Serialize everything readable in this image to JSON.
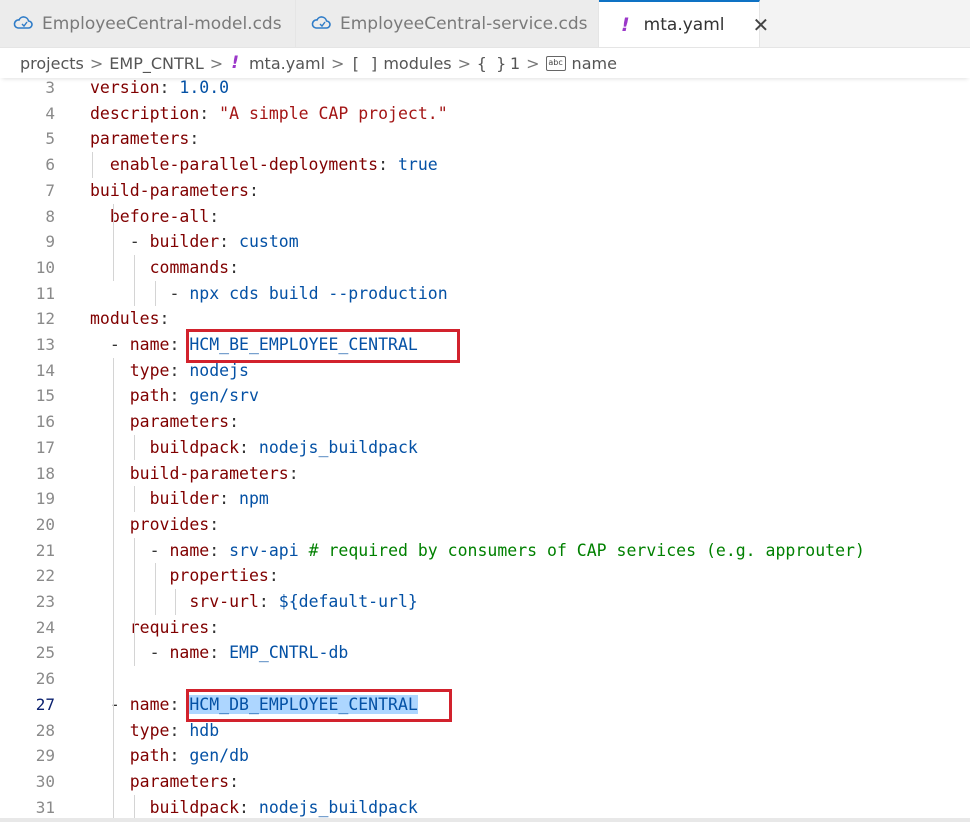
{
  "tabs": [
    {
      "label": "EmployeeCentral-model.cds",
      "icon": "cds-file-icon",
      "active": false
    },
    {
      "label": "EmployeeCentral-service.cds",
      "icon": "cds-file-icon",
      "active": false
    },
    {
      "label": "mta.yaml",
      "icon": "yaml-exclamation-icon",
      "active": true
    }
  ],
  "close_glyph": "✕",
  "breadcrumb": {
    "projects": "projects",
    "folder": "EMP_CNTRL",
    "file": "mta.yaml",
    "modules": "modules",
    "index": "1",
    "name": "name",
    "separator": ">",
    "bang": "!",
    "array_glyph": "[ ]",
    "object_glyph": "{ }",
    "abc_glyph": "abc"
  },
  "editor": {
    "lines": [
      {
        "n": "3",
        "key": "version",
        "val": "1.0.0",
        "valType": "v",
        "indent": ""
      },
      {
        "n": "4",
        "key": "description",
        "val": "\"A simple CAP project.\"",
        "valType": "s",
        "indent": ""
      },
      {
        "n": "5",
        "key": "parameters",
        "val": "",
        "valType": "",
        "indent": ""
      },
      {
        "n": "6",
        "key": "enable-parallel-deployments",
        "val": "true",
        "valType": "v",
        "indent": "  "
      },
      {
        "n": "7",
        "key": "build-parameters",
        "val": "",
        "valType": "",
        "indent": ""
      },
      {
        "n": "8",
        "key": "before-all",
        "val": "",
        "valType": "",
        "indent": "  "
      },
      {
        "n": "9",
        "key": "builder",
        "val": "custom",
        "valType": "v",
        "indent": "    - "
      },
      {
        "n": "10",
        "key": "commands",
        "val": "",
        "valType": "",
        "indent": "      "
      },
      {
        "n": "11",
        "key": "",
        "val": "npx cds build --production",
        "valType": "v",
        "indent": "        - "
      },
      {
        "n": "12",
        "key": "modules",
        "val": "",
        "valType": "",
        "indent": ""
      },
      {
        "n": "13",
        "key": "name",
        "val": "HCM_BE_EMPLOYEE_CENTRAL",
        "valType": "v",
        "indent": "  - "
      },
      {
        "n": "14",
        "key": "type",
        "val": "nodejs",
        "valType": "v",
        "indent": "    "
      },
      {
        "n": "15",
        "key": "path",
        "val": "gen/srv",
        "valType": "v",
        "indent": "    "
      },
      {
        "n": "16",
        "key": "parameters",
        "val": "",
        "valType": "",
        "indent": "    "
      },
      {
        "n": "17",
        "key": "buildpack",
        "val": "nodejs_buildpack",
        "valType": "v",
        "indent": "      "
      },
      {
        "n": "18",
        "key": "build-parameters",
        "val": "",
        "valType": "",
        "indent": "    "
      },
      {
        "n": "19",
        "key": "builder",
        "val": "npm",
        "valType": "v",
        "indent": "      "
      },
      {
        "n": "20",
        "key": "provides",
        "val": "",
        "valType": "",
        "indent": "    "
      },
      {
        "n": "21",
        "key": "name",
        "val": "srv-api",
        "valType": "v",
        "indent": "      - ",
        "comment": "# required by consumers of CAP services (e.g. approuter)"
      },
      {
        "n": "22",
        "key": "properties",
        "val": "",
        "valType": "",
        "indent": "        "
      },
      {
        "n": "23",
        "key": "srv-url",
        "val": "${default-url}",
        "valType": "v",
        "indent": "          "
      },
      {
        "n": "24",
        "key": "requires",
        "val": "",
        "valType": "",
        "indent": "    "
      },
      {
        "n": "25",
        "key": "name",
        "val": "EMP_CNTRL-db",
        "valType": "v",
        "indent": "      - "
      },
      {
        "n": "26",
        "key": "",
        "val": "",
        "valType": "",
        "indent": ""
      },
      {
        "n": "27",
        "key": "name",
        "val": "HCM_DB_EMPLOYEE_CENTRAL",
        "valType": "v",
        "indent": "  - ",
        "selected": true,
        "current": true
      },
      {
        "n": "28",
        "key": "type",
        "val": "hdb",
        "valType": "v",
        "indent": "    "
      },
      {
        "n": "29",
        "key": "path",
        "val": "gen/db",
        "valType": "v",
        "indent": "    "
      },
      {
        "n": "30",
        "key": "parameters",
        "val": "",
        "valType": "",
        "indent": "    "
      },
      {
        "n": "31",
        "key": "buildpack",
        "val": "nodejs_buildpack",
        "valType": "v",
        "indent": "      "
      }
    ]
  },
  "colors": {
    "key": "#800000",
    "value": "#0451a5",
    "string": "#a31515",
    "comment": "#008000",
    "highlight_box": "#d2222d",
    "selection": "#add6ff"
  }
}
